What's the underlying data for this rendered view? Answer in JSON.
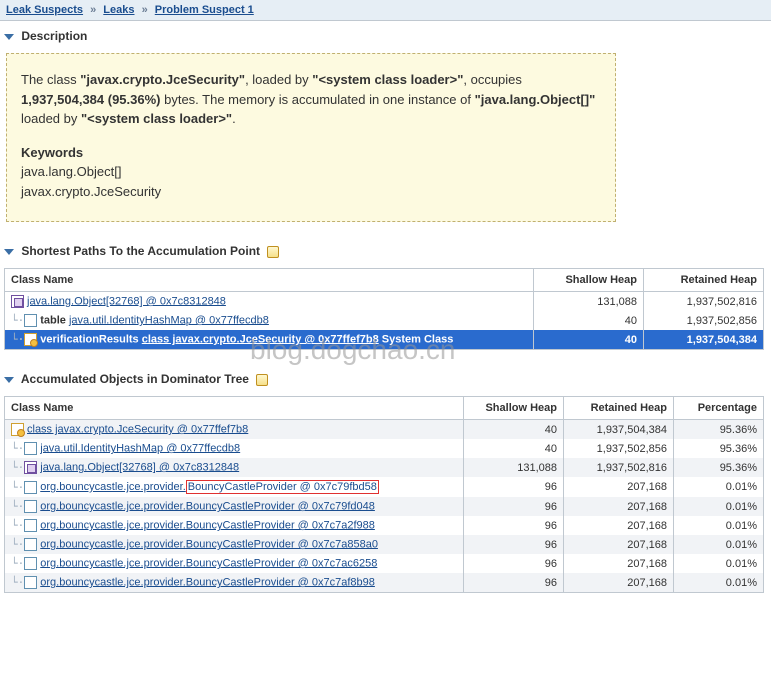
{
  "breadcrumb": {
    "items": [
      "Leak Suspects",
      "Leaks",
      "Problem Suspect 1"
    ]
  },
  "sections": {
    "description": "Description",
    "shortest_paths": "Shortest Paths To the Accumulation Point",
    "accumulated": "Accumulated Objects in Dominator Tree"
  },
  "description": {
    "prefix": "The class ",
    "class1": "\"javax.crypto.JceSecurity\"",
    "mid1": ", loaded by ",
    "loader1": "\"<system class loader>\"",
    "mid2": ", occupies ",
    "bytes": "1,937,504,384 (95.36%)",
    "mid3": " bytes. The memory is accumulated in one instance of ",
    "class2": "\"java.lang.Object[]\"",
    "mid4": " loaded by ",
    "loader2": "\"<system class loader>\"",
    "end": ".",
    "keywords_title": "Keywords",
    "kw1": "java.lang.Object[]",
    "kw2": "javax.crypto.JceSecurity"
  },
  "table1": {
    "headers": {
      "c1": "Class Name",
      "c2": "Shallow Heap",
      "c3": "Retained Heap"
    },
    "rows": [
      {
        "icon": "arr",
        "link": "java.lang.Object[32768] @ 0x7c8312848",
        "shallow": "131,088",
        "retained": "1,937,502,816",
        "indent": 0
      },
      {
        "icon": "obj",
        "pre": "table ",
        "link": "java.util.IdentityHashMap @ 0x77ffecdb8",
        "shallow": "40",
        "retained": "1,937,502,856",
        "indent": 1
      },
      {
        "icon": "class",
        "pre": "verificationResults ",
        "link": "class javax.crypto.JceSecurity @ 0x77ffef7b8",
        "post": " System Class",
        "shallow": "40",
        "retained": "1,937,504,384",
        "indent": 2,
        "selected": true
      }
    ]
  },
  "table2": {
    "headers": {
      "c1": "Class Name",
      "c2": "Shallow Heap",
      "c3": "Retained Heap",
      "c4": "Percentage"
    },
    "rows": [
      {
        "icon": "class",
        "link": "class javax.crypto.JceSecurity @ 0x77ffef7b8",
        "shallow": "40",
        "retained": "1,937,504,384",
        "pct": "95.36%",
        "indent": 0,
        "alt": true
      },
      {
        "icon": "obj",
        "link": "java.util.IdentityHashMap @ 0x77ffecdb8",
        "shallow": "40",
        "retained": "1,937,502,856",
        "pct": "95.36%",
        "indent": 1
      },
      {
        "icon": "arr",
        "link": "java.lang.Object[32768] @ 0x7c8312848",
        "shallow": "131,088",
        "retained": "1,937,502,816",
        "pct": "95.36%",
        "indent": 2,
        "alt": true
      },
      {
        "icon": "obj",
        "link_pre": "org.bouncycastle.jce.provider.",
        "link_boxed": "BouncyCastleProvider @ 0x7c79fbd58",
        "shallow": "96",
        "retained": "207,168",
        "pct": "0.01%",
        "indent": 3
      },
      {
        "icon": "obj",
        "link": "org.bouncycastle.jce.provider.BouncyCastleProvider @ 0x7c79fd048",
        "shallow": "96",
        "retained": "207,168",
        "pct": "0.01%",
        "indent": 3,
        "alt": true
      },
      {
        "icon": "obj",
        "link": "org.bouncycastle.jce.provider.BouncyCastleProvider @ 0x7c7a2f988",
        "shallow": "96",
        "retained": "207,168",
        "pct": "0.01%",
        "indent": 3
      },
      {
        "icon": "obj",
        "link": "org.bouncycastle.jce.provider.BouncyCastleProvider @ 0x7c7a858a0",
        "shallow": "96",
        "retained": "207,168",
        "pct": "0.01%",
        "indent": 3,
        "alt": true
      },
      {
        "icon": "obj",
        "link": "org.bouncycastle.jce.provider.BouncyCastleProvider @ 0x7c7ac6258",
        "shallow": "96",
        "retained": "207,168",
        "pct": "0.01%",
        "indent": 3
      },
      {
        "icon": "obj",
        "link": "org.bouncycastle.jce.provider.BouncyCastleProvider @ 0x7c7af8b98",
        "shallow": "96",
        "retained": "207,168",
        "pct": "0.01%",
        "indent": 3,
        "alt": true
      }
    ]
  },
  "watermark": "blog.dogchao.cn"
}
